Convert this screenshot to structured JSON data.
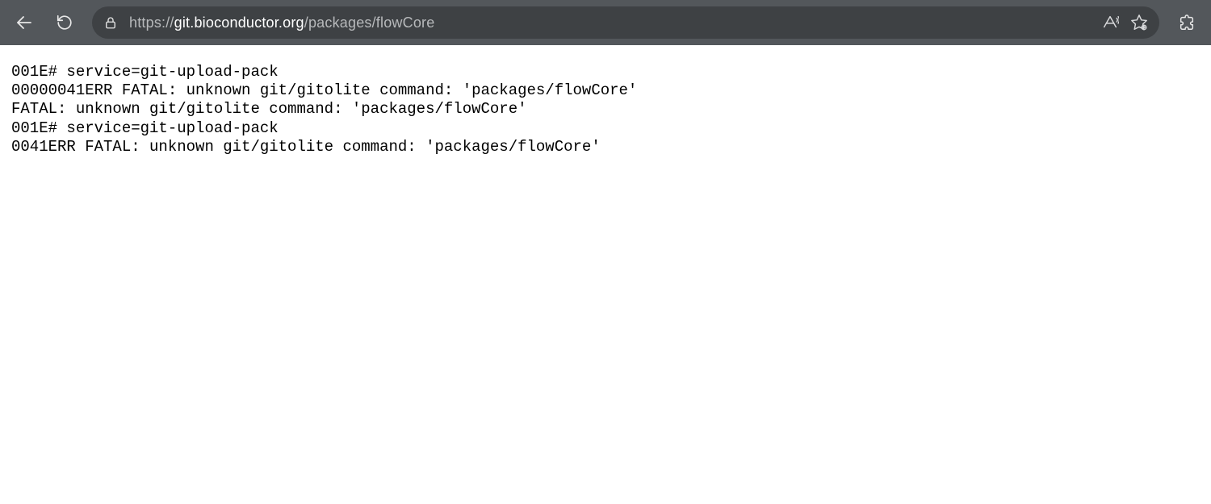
{
  "url": {
    "scheme": "https://",
    "host": "git.bioconductor.org",
    "path": "/packages/flowCore"
  },
  "page_text": "001E# service=git-upload-pack\n00000041ERR FATAL: unknown git/gitolite command: 'packages/flowCore'\nFATAL: unknown git/gitolite command: 'packages/flowCore'\n001E# service=git-upload-pack\n0041ERR FATAL: unknown git/gitolite command: 'packages/flowCore'"
}
